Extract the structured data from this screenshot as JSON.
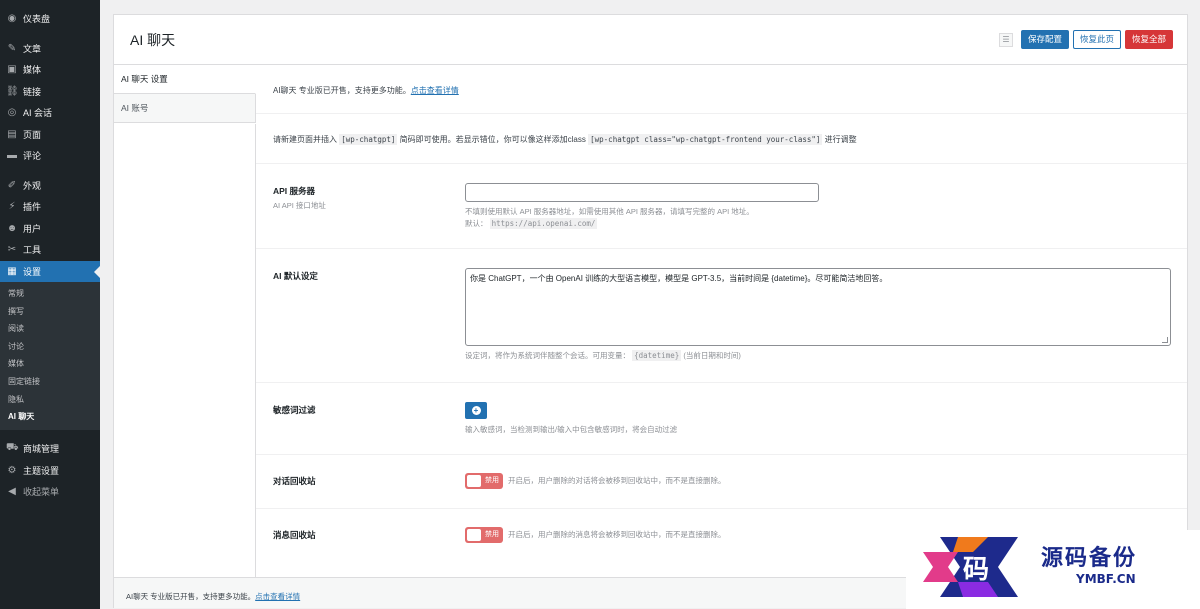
{
  "sidebar": {
    "items": [
      {
        "label": "仪表盘",
        "icon": "dashboard-icon",
        "glyph": "◉"
      },
      {
        "label": "文章",
        "icon": "pin-icon",
        "glyph": "✎"
      },
      {
        "label": "媒体",
        "icon": "media-icon",
        "glyph": "▣"
      },
      {
        "label": "链接",
        "icon": "link-icon",
        "glyph": "⛓"
      },
      {
        "label": "AI 会话",
        "icon": "ai-chat-icon",
        "glyph": "◎"
      },
      {
        "label": "页面",
        "icon": "page-icon",
        "glyph": "▤"
      },
      {
        "label": "评论",
        "icon": "comment-icon",
        "glyph": "▬"
      },
      {
        "label": "外观",
        "icon": "appearance-icon",
        "glyph": "✐"
      },
      {
        "label": "插件",
        "icon": "plugin-icon",
        "glyph": "⚡"
      },
      {
        "label": "用户",
        "icon": "user-icon",
        "glyph": "☻"
      },
      {
        "label": "工具",
        "icon": "wrench-icon",
        "glyph": "✂"
      },
      {
        "label": "设置",
        "icon": "settings-icon",
        "glyph": "▦"
      }
    ],
    "submenu": [
      "常规",
      "撰写",
      "阅读",
      "讨论",
      "媒体",
      "固定链接",
      "隐私",
      "AI 聊天"
    ],
    "bottom": [
      {
        "label": "商城管理",
        "icon": "cart-icon",
        "glyph": "⛟"
      },
      {
        "label": "主题设置",
        "icon": "gear-icon",
        "glyph": "⚙"
      },
      {
        "label": "收起菜单",
        "icon": "collapse-icon",
        "glyph": "◀"
      }
    ]
  },
  "header": {
    "title": "AI 聊天",
    "save": "保存配置",
    "reset_page": "恢复此页",
    "reset_all": "恢复全部"
  },
  "tabs": [
    "AI 聊天 设置",
    "AI 账号"
  ],
  "notice": {
    "text": "AI聊天 专业版已开售，支持更多功能。",
    "link": "点击查看详情"
  },
  "shortcode": {
    "prefix": "请新建页面并插入",
    "code1": "[wp-chatgpt]",
    "middle": "简码即可使用。若显示错位，你可以像这样添加class",
    "code2": "[wp-chatgpt class=\"wp-chatgpt-frontend your-class\"]",
    "suffix": "进行调整"
  },
  "api_server": {
    "label": "API 服务器",
    "sub": "AI API 接口地址",
    "value": "",
    "desc": "不填则使用默认 API 服务器地址，如需使用其他 API 服务器，请填写完整的 API 地址。",
    "default_label": "默认：",
    "default_value": "https://api.openai.com/"
  },
  "ai_default": {
    "label": "AI 默认设定",
    "value": "你是 ChatGPT，一个由 OpenAI 训练的大型语言模型，模型是 GPT-3.5，当前时间是 {datetime}。尽可能简洁地回答。",
    "desc_prefix": "设定词，将作为系统词伴随整个会话。可用变量：",
    "var": "{datetime}",
    "desc_suffix": "(当前日期和时间)"
  },
  "sensitive": {
    "label": "敏感词过滤",
    "desc": "输入敏感词，当检测到输出/输入中包含敏感词时，将会自动过滤"
  },
  "chat_recycle": {
    "label": "对话回收站",
    "toggle": "禁用",
    "desc": "开启后，用户删除的对话将会被移到回收站中，而不是直接删除。"
  },
  "msg_recycle": {
    "label": "消息回收站",
    "toggle": "禁用",
    "desc": "开启后，用户删除的消息将会被移到回收站中，而不是直接删除。"
  },
  "footer": {
    "text": "AI聊天 专业版已开售，支持更多功能。",
    "link": "点击查看详情"
  },
  "watermark": {
    "title": "源码备份",
    "url": "YMBF.CN",
    "logo_char": "码"
  }
}
